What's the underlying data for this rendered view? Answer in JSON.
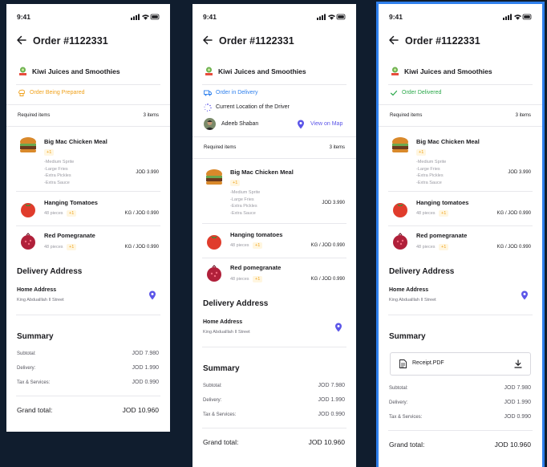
{
  "status_bar": {
    "time": "9:41"
  },
  "screens": [
    {
      "order_title": "Order #1122331",
      "restaurant": "Kiwi Juices and Smoothies",
      "status": {
        "label": "Order Being Prepared",
        "color": "#f0a11a",
        "icon": "chef-icon"
      },
      "required": {
        "label": "Required items",
        "count": "3 items"
      },
      "items": [
        {
          "name": "Big Mac Chicken Meal",
          "qty": "+1",
          "extras": [
            "-Medium Sprite",
            "-Large Fries",
            "-Extra Pickles",
            "-Extra Sauce"
          ],
          "price": "JOD 3.990"
        },
        {
          "name": "Hanging Tomatoes",
          "pieces": "48 pieces",
          "qty": "+1",
          "price": "KG / JOD 0.990"
        },
        {
          "name": "Red Pomegranate",
          "pieces": "48 pieces",
          "qty": "+1",
          "price": "KG / JOD 0.990"
        }
      ],
      "delivery": {
        "title": "Delivery Address",
        "label": "Home Address",
        "street": "King Abdualllah II Street"
      },
      "summary": {
        "title": "Summary",
        "rows": [
          {
            "label": "Subtotal:",
            "value": "JOD 7.980"
          },
          {
            "label": "Delivery:",
            "value": "JOD 1.990"
          },
          {
            "label": "Tax & Services:",
            "value": "JOD 0.990"
          }
        ],
        "grand_label": "Grand total:",
        "grand_value": "JOD 10.960"
      }
    },
    {
      "order_title": "Order #1122331",
      "restaurant": "Kiwi Juices and Smoothies",
      "status": {
        "label": "Order in Delivery",
        "color": "#2f80ed",
        "icon": "truck-icon"
      },
      "location_label": "Current Location of the Driver",
      "driver": {
        "name": "Adeeb Shaban",
        "map_link": "View on Map"
      },
      "required": {
        "label": "Required items",
        "count": "3 items"
      },
      "items": [
        {
          "name": "Big Mac Chicken Meal",
          "qty": "+1",
          "extras": [
            "-Medium Sprite",
            "-Large Fries",
            "-Extra Pickles",
            "-Extra Sauce"
          ],
          "price": "JOD 3.990"
        },
        {
          "name": "Hanging tomatoes",
          "pieces": "48 pieces",
          "qty": "+1",
          "price": "KG / JOD 0.990"
        },
        {
          "name": "Red pomegranate",
          "pieces": "48 pieces",
          "qty": "+1",
          "price": "KG / JOD 0.990"
        }
      ],
      "delivery": {
        "title": "Delivery Address",
        "label": "Home Address",
        "street": "King Abdualllah II Street"
      },
      "summary": {
        "title": "Summary",
        "rows": [
          {
            "label": "Subtotal:",
            "value": "JOD 7.980"
          },
          {
            "label": "Delivery:",
            "value": "JOD 1.990"
          },
          {
            "label": "Tax & Services:",
            "value": "JOD 0.990"
          }
        ],
        "grand_label": "Grand total:",
        "grand_value": "JOD 10.960"
      }
    },
    {
      "order_title": "Order #1122331",
      "restaurant": "Kiwi Juices and Smoothies",
      "status": {
        "label": "Order Delivered",
        "color": "#2aa84a",
        "icon": "check-icon"
      },
      "required": {
        "label": "Required items",
        "count": "3 items"
      },
      "items": [
        {
          "name": "Big Mac Chicken Meal",
          "qty": "+1",
          "extras": [
            "-Medium Sprite",
            "-Large Fries",
            "-Extra Pickles",
            "-Extra Sauce"
          ],
          "price": "JOD 3.990"
        },
        {
          "name": "Hanging tomatoes",
          "pieces": "48 pieces",
          "qty": "+1",
          "price": "KG / JOD 0.990"
        },
        {
          "name": "Red pomegranate",
          "pieces": "48 pieces",
          "qty": "+1",
          "price": "KG / JOD 0.990"
        }
      ],
      "delivery": {
        "title": "Delivery Address",
        "label": "Home Address",
        "street": "King Abdualllah II Street"
      },
      "receipt": "Receipt.PDF",
      "summary": {
        "title": "Summary",
        "rows": [
          {
            "label": "Subtotal:",
            "value": "JOD 7.980"
          },
          {
            "label": "Delivery:",
            "value": "JOD 1.990"
          },
          {
            "label": "Tax & Services:",
            "value": "JOD 0.990"
          }
        ],
        "grand_label": "Grand total:",
        "grand_value": "JOD 10.960"
      }
    }
  ]
}
